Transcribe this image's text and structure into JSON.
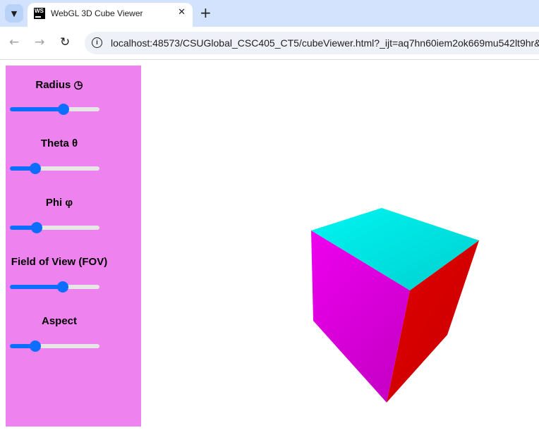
{
  "browser": {
    "tab_title": "WebGL 3D Cube Viewer",
    "favicon_text": "WS",
    "url": "localhost:48573/CSUGlobal_CSC405_CT5/cubeViewer.html?_ijt=aq7hn60iem2ok669mu542lt9hr&_ij"
  },
  "controls": [
    {
      "label": "Radius ◷",
      "fraction": 0.6
    },
    {
      "label": "Theta θ",
      "fraction": 0.28
    },
    {
      "label": "Phi φ",
      "fraction": 0.3
    },
    {
      "label": "Field of View (FOV)",
      "fraction": 0.59
    },
    {
      "label": "Aspect",
      "fraction": 0.28
    }
  ],
  "colors": {
    "panel": "#ee82ee",
    "slider_accent": "#0d6efd",
    "cube_top": "#00f5f2",
    "cube_left": "#ee00ee",
    "cube_right": "#e00000"
  }
}
